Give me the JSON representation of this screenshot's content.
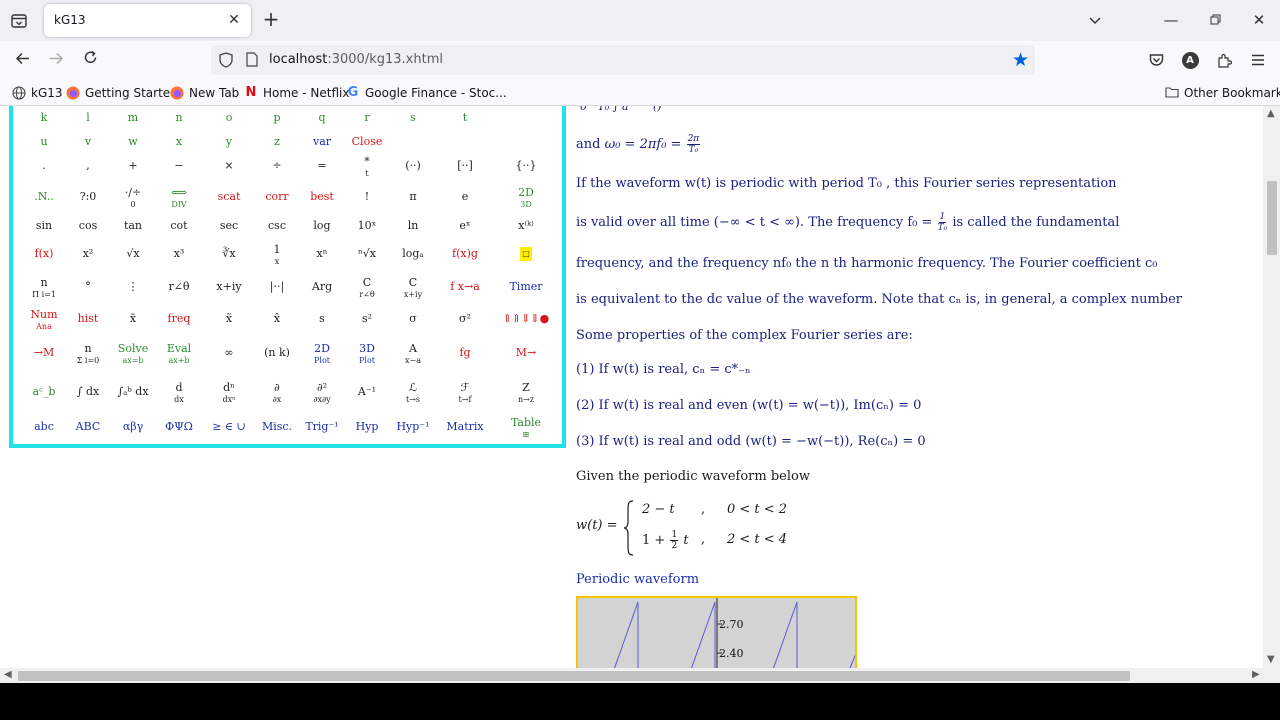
{
  "browser": {
    "tab_title": "kG13",
    "url_host": "localhost",
    "url_rest": ":3000/kg13.xhtml",
    "bookmarks": [
      {
        "label": "kG13",
        "icon": "globe-icon"
      },
      {
        "label": "Getting Started",
        "icon": "firefox-icon"
      },
      {
        "label": "New Tab",
        "icon": "firefox-icon"
      },
      {
        "label": "Home - Netflix",
        "icon": "netflix-icon"
      },
      {
        "label": "Google Finance - Stoc...",
        "icon": "google-icon"
      }
    ],
    "other_bookmarks": "Other Bookmarks",
    "avatar_letter": "A",
    "accent": "#0061e0"
  },
  "palette": {
    "border_color": "#22e1e6",
    "rows": [
      [
        {
          "t": "k",
          "c": "g"
        },
        {
          "t": "l",
          "c": "g"
        },
        {
          "t": "m",
          "c": "g"
        },
        {
          "t": "n",
          "c": "g"
        },
        {
          "t": "o",
          "c": "g"
        },
        {
          "t": "p",
          "c": "g"
        },
        {
          "t": "q",
          "c": "g"
        },
        {
          "t": "r",
          "c": "g"
        },
        {
          "t": "s",
          "c": "g"
        },
        {
          "t": "t",
          "c": "g"
        }
      ],
      [
        {
          "t": "u",
          "c": "g"
        },
        {
          "t": "v",
          "c": "g"
        },
        {
          "t": "w",
          "c": "g"
        },
        {
          "t": "x",
          "c": "g"
        },
        {
          "t": "y",
          "c": "g"
        },
        {
          "t": "z",
          "c": "g"
        },
        {
          "t": "var",
          "c": "b"
        },
        {
          "t": "Close",
          "c": "r"
        }
      ],
      [
        {
          "t": ".",
          "c": "k"
        },
        {
          "t": ",",
          "c": "k"
        },
        {
          "t": "+",
          "c": "k"
        },
        {
          "t": "−",
          "c": "k"
        },
        {
          "t": "×",
          "c": "k"
        },
        {
          "t": "÷",
          "c": "k"
        },
        {
          "t": "=",
          "c": "k"
        },
        {
          "t": "*",
          "s": "t",
          "c": "k"
        },
        {
          "t": "(··)",
          "c": "k"
        },
        {
          "t": "[··]",
          "c": "k"
        },
        {
          "t": "{··}",
          "c": "k"
        }
      ],
      [
        {
          "t": ".N..",
          "c": "g"
        },
        {
          "t": "?:0",
          "c": "k"
        },
        {
          "t": "·/÷",
          "s": "0",
          "c": "k"
        },
        {
          "t": "⟺",
          "s": "DIV",
          "c": "g"
        },
        {
          "t": "scat",
          "c": "r"
        },
        {
          "t": "corr",
          "c": "r"
        },
        {
          "t": "best",
          "c": "r"
        },
        {
          "t": "!",
          "c": "k"
        },
        {
          "t": "π",
          "c": "k"
        },
        {
          "t": "e",
          "c": "k"
        },
        {
          "t": "2D",
          "s": "3D",
          "c": "g"
        }
      ],
      [
        {
          "t": "sin",
          "c": "k"
        },
        {
          "t": "cos",
          "c": "k"
        },
        {
          "t": "tan",
          "c": "k"
        },
        {
          "t": "cot",
          "c": "k"
        },
        {
          "t": "sec",
          "c": "k"
        },
        {
          "t": "csc",
          "c": "k"
        },
        {
          "t": "log",
          "c": "k"
        },
        {
          "t": "10ˣ",
          "c": "k"
        },
        {
          "t": "ln",
          "c": "k"
        },
        {
          "t": "eˣ",
          "c": "k"
        },
        {
          "t": "x⁽ᵏ⁾",
          "c": "k"
        }
      ],
      [
        {
          "t": "f(x)",
          "c": "r"
        },
        {
          "t": "x²",
          "c": "k"
        },
        {
          "t": "√x",
          "c": "k"
        },
        {
          "t": "x³",
          "c": "k"
        },
        {
          "t": "∛x",
          "c": "k"
        },
        {
          "t": "1",
          "s": "x",
          "c": "k"
        },
        {
          "t": "xⁿ",
          "c": "k"
        },
        {
          "t": "ⁿ√x",
          "c": "k"
        },
        {
          "t": "logₐ",
          "c": "k"
        },
        {
          "t": "f(x)g",
          "c": "r"
        },
        {
          "t": "□",
          "c": "y"
        }
      ],
      [
        {
          "t": "n",
          "s": "Π i=1",
          "c": "k"
        },
        {
          "t": "°",
          "c": "k"
        },
        {
          "t": "⋮",
          "c": "k"
        },
        {
          "t": "r∠θ",
          "c": "k"
        },
        {
          "t": "x+iy",
          "c": "k"
        },
        {
          "t": "|··|",
          "c": "k"
        },
        {
          "t": "Arg",
          "c": "k"
        },
        {
          "t": "C",
          "s": "r∠θ",
          "c": "k"
        },
        {
          "t": "C",
          "s": "x+iy",
          "c": "k"
        },
        {
          "t": "f x→a",
          "c": "r"
        },
        {
          "t": "Timer",
          "c": "b"
        }
      ],
      [
        {
          "t": "Num",
          "s": "Ana",
          "c": "r"
        },
        {
          "t": "hist",
          "c": "r"
        },
        {
          "t": "x̄",
          "c": "k"
        },
        {
          "t": "freq",
          "c": "r"
        },
        {
          "t": "x̃",
          "c": "k"
        },
        {
          "t": "x̂",
          "c": "k"
        },
        {
          "t": "s",
          "c": "k"
        },
        {
          "t": "s²",
          "c": "k"
        },
        {
          "t": "σ",
          "c": "k"
        },
        {
          "t": "σ²",
          "c": "k"
        },
        {
          "t": "⇑⇑⇓⇓●",
          "c": "r"
        }
      ],
      [
        {
          "t": "→M",
          "c": "r"
        },
        {
          "t": "n",
          "s": "Σ i=0",
          "c": "k"
        },
        {
          "t": "Solve",
          "s": "ax=b",
          "c": "g"
        },
        {
          "t": "Eval",
          "s": "ax+b",
          "c": "g"
        },
        {
          "t": "∞",
          "c": "k"
        },
        {
          "t": "(n k)",
          "c": "k"
        },
        {
          "t": "2D",
          "s": "Plot",
          "c": "b"
        },
        {
          "t": "3D",
          "s": "Plot",
          "c": "b"
        },
        {
          "t": "A",
          "s": "x−a",
          "c": "k"
        },
        {
          "t": "fg",
          "c": "r"
        },
        {
          "t": "M→",
          "c": "r"
        }
      ],
      [
        {
          "t": "aᶜ_b",
          "c": "g"
        },
        {
          "t": "∫ dx",
          "c": "k"
        },
        {
          "t": "∫ₐᵇ dx",
          "c": "k"
        },
        {
          "t": "d",
          "s": "dx",
          "c": "k"
        },
        {
          "t": "dⁿ",
          "s": "dxⁿ",
          "c": "k"
        },
        {
          "t": "∂",
          "s": "∂x",
          "c": "k"
        },
        {
          "t": "∂²",
          "s": "∂x∂y",
          "c": "k"
        },
        {
          "t": "A⁻¹",
          "c": "k"
        },
        {
          "t": "ℒ",
          "s": "t→s",
          "c": "k"
        },
        {
          "t": "ℱ",
          "s": "t→f",
          "c": "k"
        },
        {
          "t": "Z",
          "s": "n→z",
          "c": "k"
        }
      ],
      [
        {
          "t": "abc",
          "c": "b"
        },
        {
          "t": "ABC",
          "c": "b"
        },
        {
          "t": "αβγ",
          "c": "b"
        },
        {
          "t": "ΦΨΩ",
          "c": "b"
        },
        {
          "t": "≥ ∈ ∪",
          "c": "b"
        },
        {
          "t": "Misc.",
          "c": "b"
        },
        {
          "t": "Trig⁻¹",
          "c": "b"
        },
        {
          "t": "Hyp",
          "c": "b"
        },
        {
          "t": "Hyp⁻¹",
          "c": "b"
        },
        {
          "t": "Matrix",
          "c": "b"
        },
        {
          "t": "Table",
          "s": "⊞",
          "c": "g"
        }
      ]
    ]
  },
  "article": {
    "omega_line": {
      "prefix": "and",
      "expr": "ω₀ = 2πf₀ =",
      "num": "2π",
      "den": "T₀"
    },
    "p1": "If the waveform w(t) is periodic with period T₀ , this Fourier series representation",
    "p2a": "is valid over all time (−∞ < t < ∞). The frequency f₀ =",
    "p2_num": "1",
    "p2_den": "T₀",
    "p2b": "is called the fundamental",
    "p3": "frequency, and the frequency nf₀ the n th harmonic frequency. The Fourier coefficient c₀",
    "p4": "is equivalent to the dc value of the waveform. Note that cₙ is, in general, a complex number",
    "p5": "Some properties of the complex Fourier series are:",
    "prop1": "(1) If w(t) is real, cₙ = c*₋ₙ",
    "prop2": "(2) If w(t) is real and even (w(t) = w(−t)), Im(cₙ) = 0",
    "prop3": "(3) If w(t) is real and odd (w(t) = −w(−t)), Re(cₙ) = 0",
    "given": "Given the periodic waveform below",
    "piecewise": {
      "lhs": "w(t) =",
      "c1": "2 − t",
      "r1": "0 < t < 2",
      "c2_pre": "1 +",
      "c2_num": "1",
      "c2_den": "2",
      "c2_post": "t",
      "r2": "2 < t < 4",
      "sep": ","
    },
    "graph_title": "Periodic waveform",
    "graph_ticks": [
      "2.70",
      "2.40"
    ]
  }
}
